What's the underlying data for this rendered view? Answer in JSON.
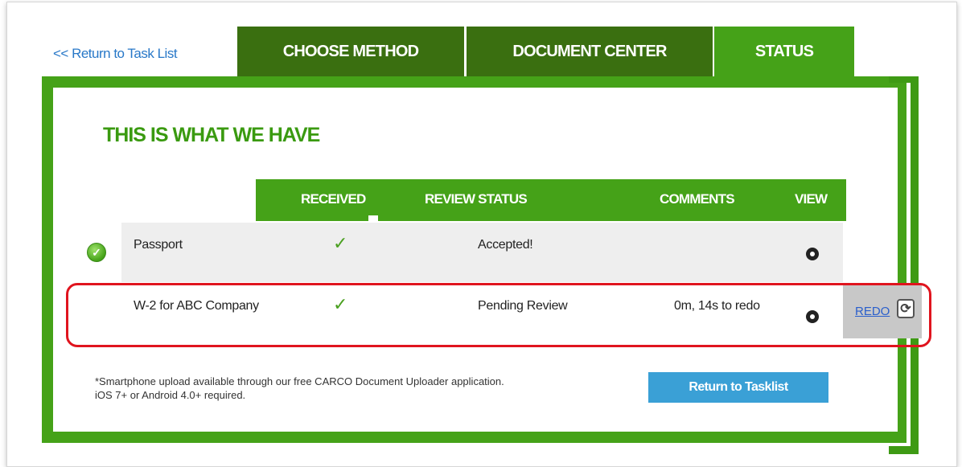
{
  "nav": {
    "return_link": "<< Return to Task List",
    "tabs": [
      {
        "label": "CHOOSE METHOD"
      },
      {
        "label": "DOCUMENT CENTER"
      },
      {
        "label": "STATUS"
      }
    ]
  },
  "panel": {
    "heading": "THIS IS WHAT WE HAVE",
    "columns": [
      "RECEIVED",
      "REVIEW STATUS",
      "COMMENTS",
      "VIEW"
    ],
    "rows": [
      {
        "document": "Passport",
        "received": "✓",
        "review_status": "Accepted!",
        "comments": ""
      },
      {
        "document": "W-2 for ABC Company",
        "received": "✓",
        "review_status": "Pending Review",
        "comments": "0m, 14s to redo",
        "redo_label": "REDO"
      }
    ],
    "footnote_line1": "*Smartphone upload available through our free CARCO Document Uploader application.",
    "footnote_line2": "iOS 7+ or Android 4.0+ required.",
    "return_button": "Return to Tasklist"
  },
  "colors": {
    "tab_dark": "#3a6f10",
    "accent_green": "#45a218",
    "button_blue": "#3aa0d6",
    "highlight_red": "#e0141e"
  },
  "icons": {
    "accepted": "check-circle-icon",
    "view": "eye-icon",
    "redo": "refresh-icon"
  }
}
